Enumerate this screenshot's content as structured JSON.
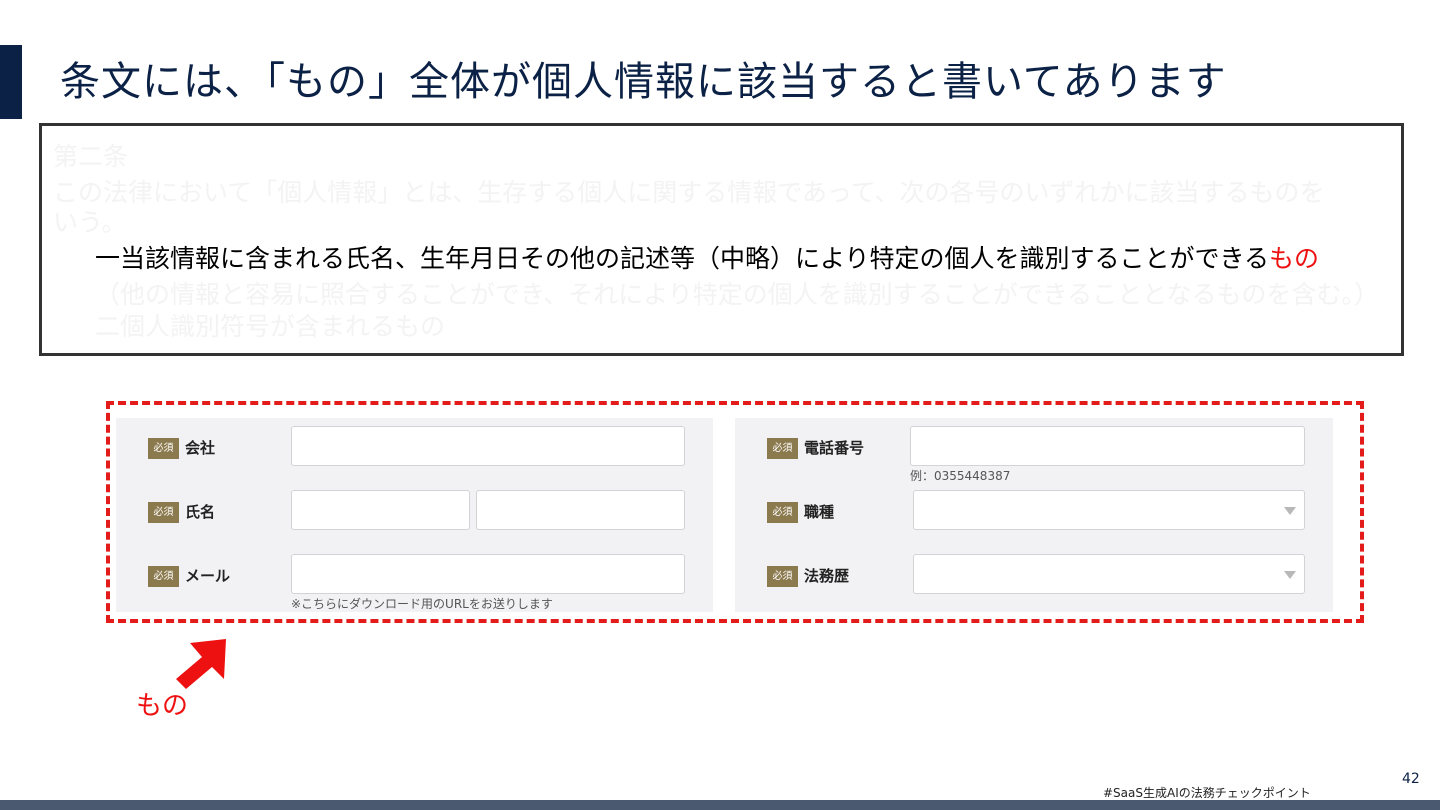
{
  "slide": {
    "title": "条文には、「もの」全体が個人情報に該当すると書いてあります",
    "page_number": "42",
    "hashtag": "#SaaS生成AIの法務チェックポイント"
  },
  "law_text": {
    "line1": "第二条",
    "line2": "この法律において「個人情報」とは、生存する個人に関する情報であって、次の各号のいずれかに該当するものを",
    "line3": "いう。",
    "line4_main": "一当該情報に含まれる氏名、生年月日その他の記述等（中略）により特定の個人を識別することができる",
    "line4_highlight": "もの",
    "line5": "（他の情報と容易に照合することができ、それにより特定の個人を識別することができることとなるものを含む。）",
    "line6": "二個人識別符号が含まれるもの"
  },
  "form": {
    "required_badge": "必須",
    "left_fields": [
      {
        "label": "会社",
        "value": ""
      },
      {
        "label": "氏名",
        "value_last": "",
        "value_first": ""
      },
      {
        "label": "メール",
        "value": "",
        "note": "※こちらにダウンロード用のURLをお送りします"
      }
    ],
    "right_fields": [
      {
        "label": "電話番号",
        "value": "",
        "note": "例：0355448387"
      },
      {
        "label": "職種",
        "value": ""
      },
      {
        "label": "法務歴",
        "value": ""
      }
    ]
  },
  "annotation": {
    "label": "もの",
    "color": "#ee1111"
  },
  "colors": {
    "title": "#0b2145",
    "accent_bar": "#0b2145",
    "highlight": "#ee1111",
    "dashed_border": "#e31b1b",
    "required_badge": "#8c7a4f",
    "footer_bar": "#4a5870"
  },
  "icons": [
    "arrow-up-right-icon",
    "dropdown-arrow-icon"
  ]
}
